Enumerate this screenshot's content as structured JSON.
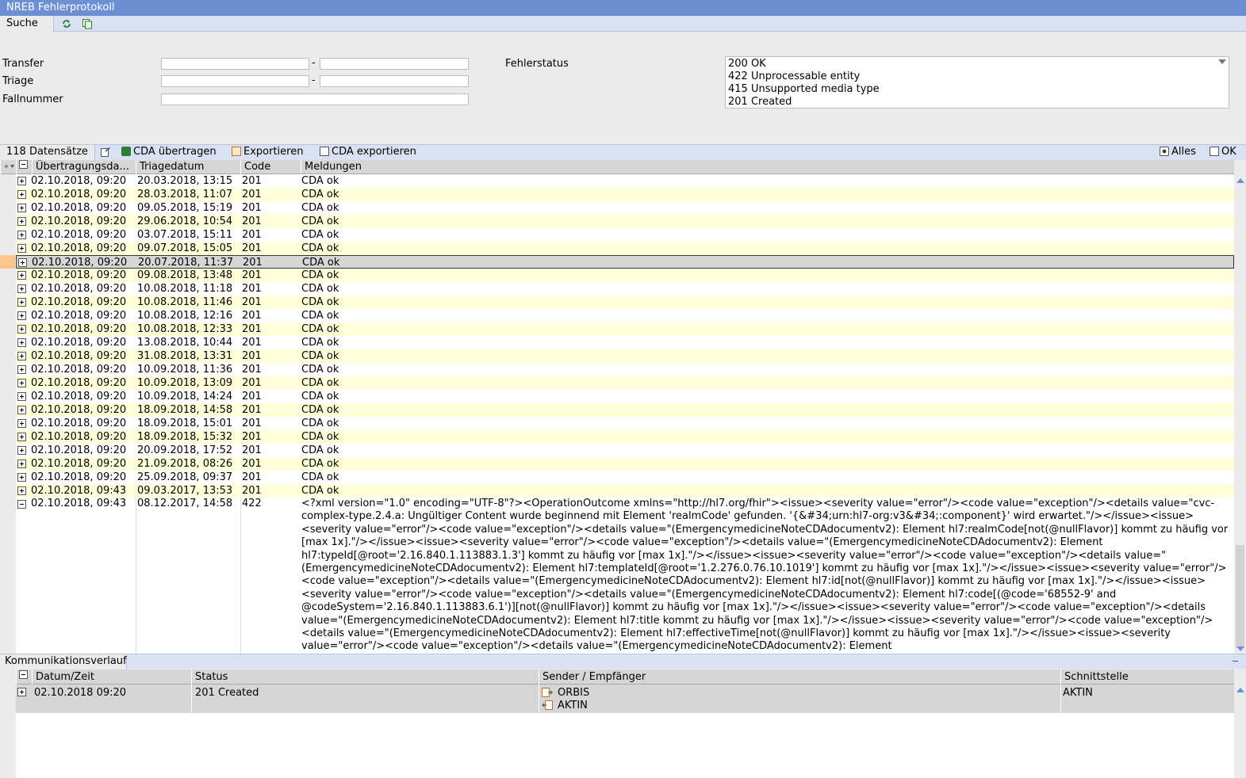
{
  "window": {
    "title": "NREB Fehlerprotokoll"
  },
  "tabbar": {
    "active_tab": "Suche",
    "icons": [
      "refresh-icon",
      "copy-icon"
    ]
  },
  "search": {
    "transfer_label": "Transfer",
    "triage_label": "Triage",
    "fallnummer_label": "Fallnummer",
    "range_separator": "-",
    "fehlerstatus_label": "Fehlerstatus",
    "status_options": [
      "200 OK",
      "422 Unprocessable entity",
      "415 Unsupported media type",
      "201 Created"
    ]
  },
  "toolbar": {
    "record_count": "118 Datensätze",
    "cda_transfer": "CDA übertragen",
    "export": "Exportieren",
    "cda_export": "CDA exportieren",
    "filter_all": "Alles",
    "filter_ok": "OK"
  },
  "table": {
    "headers": [
      "Übertragungsda...",
      "Triagedatum",
      "Code",
      "Meldungen"
    ],
    "rows": [
      [
        "02.10.2018, 09:20",
        "20.03.2018, 13:15",
        "201",
        "CDA ok"
      ],
      [
        "02.10.2018, 09:20",
        "28.03.2018, 11:07",
        "201",
        "CDA ok"
      ],
      [
        "02.10.2018, 09:20",
        "09.05.2018, 15:19",
        "201",
        "CDA ok"
      ],
      [
        "02.10.2018, 09:20",
        "29.06.2018, 10:54",
        "201",
        "CDA ok"
      ],
      [
        "02.10.2018, 09:20",
        "03.07.2018, 15:11",
        "201",
        "CDA ok"
      ],
      [
        "02.10.2018, 09:20",
        "09.07.2018, 15:05",
        "201",
        "CDA ok"
      ],
      [
        "02.10.2018, 09:20",
        "20.07.2018, 11:37",
        "201",
        "CDA ok"
      ],
      [
        "02.10.2018, 09:20",
        "09.08.2018, 13:48",
        "201",
        "CDA ok"
      ],
      [
        "02.10.2018, 09:20",
        "10.08.2018, 11:18",
        "201",
        "CDA ok"
      ],
      [
        "02.10.2018, 09:20",
        "10.08.2018, 11:46",
        "201",
        "CDA ok"
      ],
      [
        "02.10.2018, 09:20",
        "10.08.2018, 12:16",
        "201",
        "CDA ok"
      ],
      [
        "02.10.2018, 09:20",
        "10.08.2018, 12:33",
        "201",
        "CDA ok"
      ],
      [
        "02.10.2018, 09:20",
        "13.08.2018, 10:44",
        "201",
        "CDA ok"
      ],
      [
        "02.10.2018, 09:20",
        "31.08.2018, 13:31",
        "201",
        "CDA ok"
      ],
      [
        "02.10.2018, 09:20",
        "10.09.2018, 11:36",
        "201",
        "CDA ok"
      ],
      [
        "02.10.2018, 09:20",
        "10.09.2018, 13:09",
        "201",
        "CDA ok"
      ],
      [
        "02.10.2018, 09:20",
        "10.09.2018, 14:24",
        "201",
        "CDA ok"
      ],
      [
        "02.10.2018, 09:20",
        "18.09.2018, 14:58",
        "201",
        "CDA ok"
      ],
      [
        "02.10.2018, 09:20",
        "18.09.2018, 15:01",
        "201",
        "CDA ok"
      ],
      [
        "02.10.2018, 09:20",
        "18.09.2018, 15:32",
        "201",
        "CDA ok"
      ],
      [
        "02.10.2018, 09:20",
        "20.09.2018, 17:52",
        "201",
        "CDA ok"
      ],
      [
        "02.10.2018, 09:20",
        "21.09.2018, 08:26",
        "201",
        "CDA ok"
      ],
      [
        "02.10.2018, 09:20",
        "25.09.2018, 09:37",
        "201",
        "CDA ok"
      ],
      [
        "02.10.2018, 09:43",
        "09.03.2017, 13:53",
        "201",
        "CDA ok"
      ]
    ],
    "expanded_row": {
      "transfer": "02.10.2018, 09:43",
      "triage": "08.12.2017, 14:58",
      "code": "422",
      "message": "<?xml version=\"1.0\" encoding=\"UTF-8\"?><OperationOutcome xmlns=\"http://hl7.org/fhir\"><issue><severity value=\"error\"/><code value=\"exception\"/><details value=\"cvc-complex-type.2.4.a: Ungültiger Content wurde beginnend mit Element 'realmCode' gefunden. '{&#34;urn:hl7-org:v3&#34;:component}' wird erwartet.\"/></issue><issue><severity value=\"error\"/><code value=\"exception\"/><details value=\"(EmergencymedicineNoteCDAdocumentv2): Element hl7:realmCode[not(@nullFlavor)] kommt zu häufig vor [max 1x].\"/></issue><issue><severity value=\"error\"/><code value=\"exception\"/><details value=\"(EmergencymedicineNoteCDAdocumentv2): Element hl7:typeId[@root='2.16.840.1.113883.1.3'] kommt zu häufig vor [max 1x].\"/></issue><issue><severity value=\"error\"/><code value=\"exception\"/><details value=\"(EmergencymedicineNoteCDAdocumentv2): Element hl7:templateId[@root='1.2.276.0.76.10.1019'] kommt zu häufig vor [max 1x].\"/></issue><issue><severity value=\"error\"/><code value=\"exception\"/><details value=\"(EmergencymedicineNoteCDAdocumentv2): Element hl7:id[not(@nullFlavor)] kommt zu häufig vor [max 1x].\"/></issue><issue><severity value=\"error\"/><code value=\"exception\"/><details value=\"(EmergencymedicineNoteCDAdocumentv2): Element hl7:code[(@code='68552-9' and @codeSystem='2.16.840.1.113883.6.1')][not(@nullFlavor)] kommt zu häufig vor [max 1x].\"/></issue><issue><severity value=\"error\"/><code value=\"exception\"/><details value=\"(EmergencymedicineNoteCDAdocumentv2): Element hl7:title kommt zu häufig vor [max 1x].\"/></issue><issue><severity value=\"error\"/><code value=\"exception\"/><details value=\"(EmergencymedicineNoteCDAdocumentv2): Element hl7:effectiveTime[not(@nullFlavor)] kommt zu häufig vor [max 1x].\"/></issue><issue><severity value=\"error\"/><code value=\"exception\"/><details value=\"(EmergencymedicineNoteCDAdocumentv2): Element"
    }
  },
  "communication": {
    "tab_label": "Kommunikationsverlauf",
    "headers": [
      "Datum/Zeit",
      "Status",
      "Sender / Empfänger",
      "Schnittstelle"
    ],
    "row": {
      "datetime": "02.10.2018 09:20",
      "status": "201 Created",
      "sender": "ORBIS",
      "receiver": "AKTIN",
      "interface": "AKTIN"
    }
  },
  "colors": {
    "titlebar": "#6d8fd3",
    "toolbar": "#d9e1f2",
    "alt_row": "#ffffd9",
    "selected_row": "#d6d6d6"
  }
}
